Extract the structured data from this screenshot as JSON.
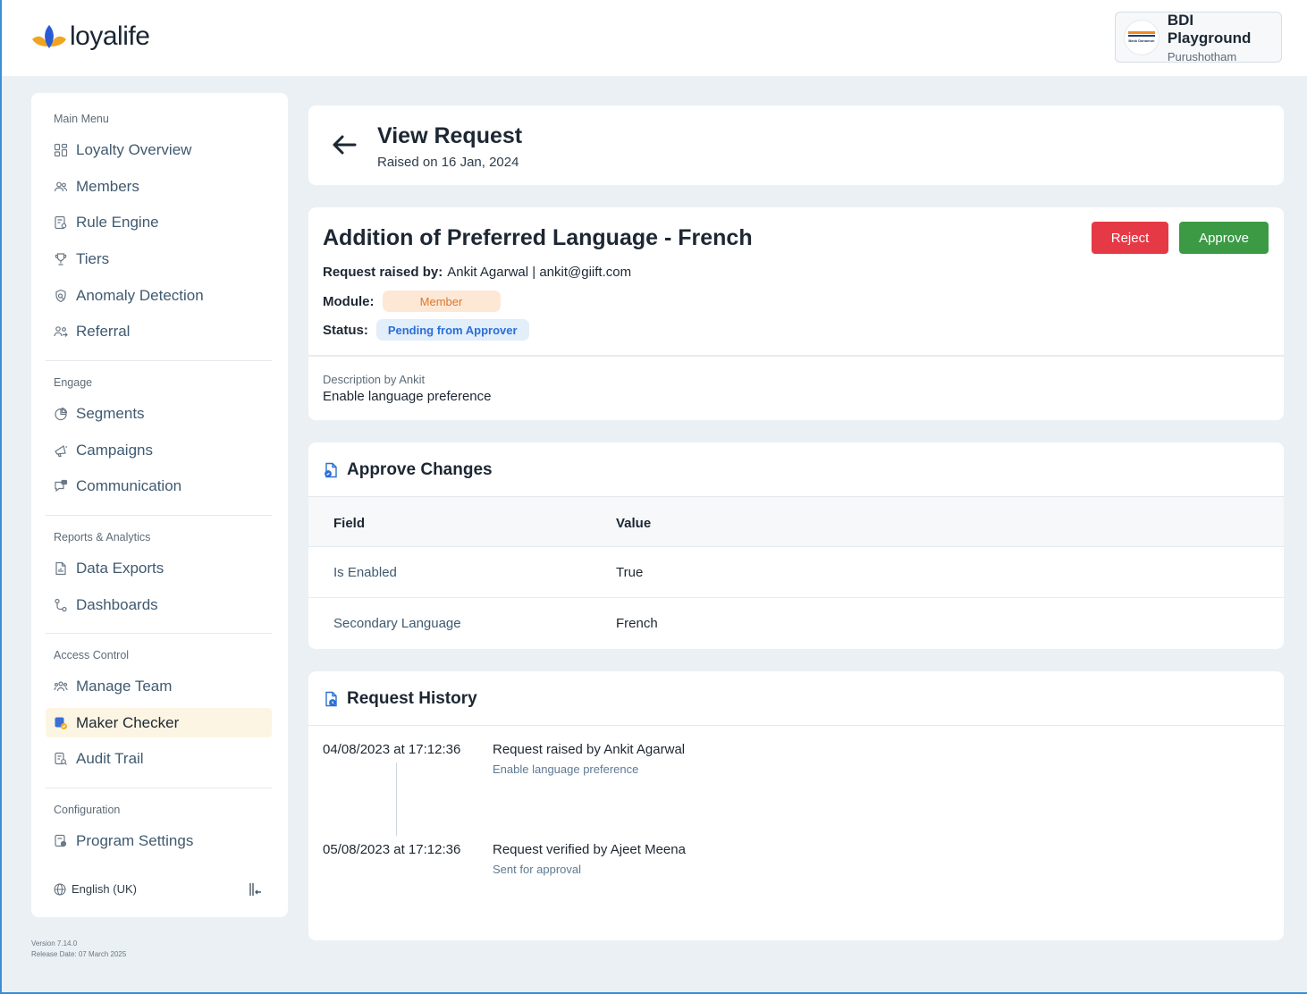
{
  "brand": {
    "name": "loyalife"
  },
  "org": {
    "name": "BDI Playground",
    "user": "Purushotham",
    "logo_text": "Bank Danamon"
  },
  "sidebar": {
    "sections": [
      {
        "title": "Main Menu",
        "items": [
          {
            "label": "Loyalty Overview",
            "icon": "grid-icon"
          },
          {
            "label": "Members",
            "icon": "members-icon"
          },
          {
            "label": "Rule Engine",
            "icon": "rule-engine-icon"
          },
          {
            "label": "Tiers",
            "icon": "trophy-icon"
          },
          {
            "label": "Anomaly Detection",
            "icon": "anomaly-icon"
          },
          {
            "label": "Referral",
            "icon": "referral-icon"
          }
        ]
      },
      {
        "title": "Engage",
        "items": [
          {
            "label": "Segments",
            "icon": "pie-icon"
          },
          {
            "label": "Campaigns",
            "icon": "megaphone-icon"
          },
          {
            "label": "Communication",
            "icon": "chat-icon"
          }
        ]
      },
      {
        "title": "Reports & Analytics",
        "items": [
          {
            "label": "Data Exports",
            "icon": "file-icon"
          },
          {
            "label": "Dashboards",
            "icon": "dashboard-icon"
          }
        ]
      },
      {
        "title": "Access Control",
        "items": [
          {
            "label": "Manage Team",
            "icon": "team-icon"
          },
          {
            "label": "Maker Checker",
            "icon": "maker-checker-icon",
            "active": true
          },
          {
            "label": "Audit Trail",
            "icon": "audit-icon"
          }
        ]
      },
      {
        "title": "Configuration",
        "items": [
          {
            "label": "Program Settings",
            "icon": "settings-icon"
          }
        ]
      }
    ],
    "language": "English (UK)",
    "version": "Version 7.14.0",
    "release": "Release Date: 07 March 2025"
  },
  "view_request": {
    "title": "View Request",
    "raised_on": "Raised on 16 Jan, 2024"
  },
  "request": {
    "title": "Addition of Preferred Language - French",
    "raised_by_label": "Request raised by:",
    "raised_by_value": "Ankit Agarwal | ankit@giift.com",
    "module_label": "Module:",
    "module_value": "Member",
    "status_label": "Status:",
    "status_value": "Pending from Approver",
    "reject_label": "Reject",
    "approve_label": "Approve",
    "description_label": "Description by Ankit",
    "description_text": "Enable language preference",
    "colors": {
      "reject": "#e63946",
      "approve": "#3c9a45",
      "module_bg": "#fde8d6",
      "status_bg": "#e3eefb"
    }
  },
  "changes": {
    "title": "Approve Changes",
    "columns": [
      "Field",
      "Value"
    ],
    "rows": [
      {
        "field": "Is Enabled",
        "value": "True"
      },
      {
        "field": "Secondary Language",
        "value": "French"
      }
    ]
  },
  "history": {
    "title": "Request History",
    "entries": [
      {
        "date": "04/08/2023 at 17:12:36",
        "title": "Request raised by Ankit Agarwal",
        "sub": "Enable language preference"
      },
      {
        "date": "05/08/2023 at 17:12:36",
        "title": "Request verified by Ajeet Meena",
        "sub": "Sent for approval"
      }
    ]
  }
}
